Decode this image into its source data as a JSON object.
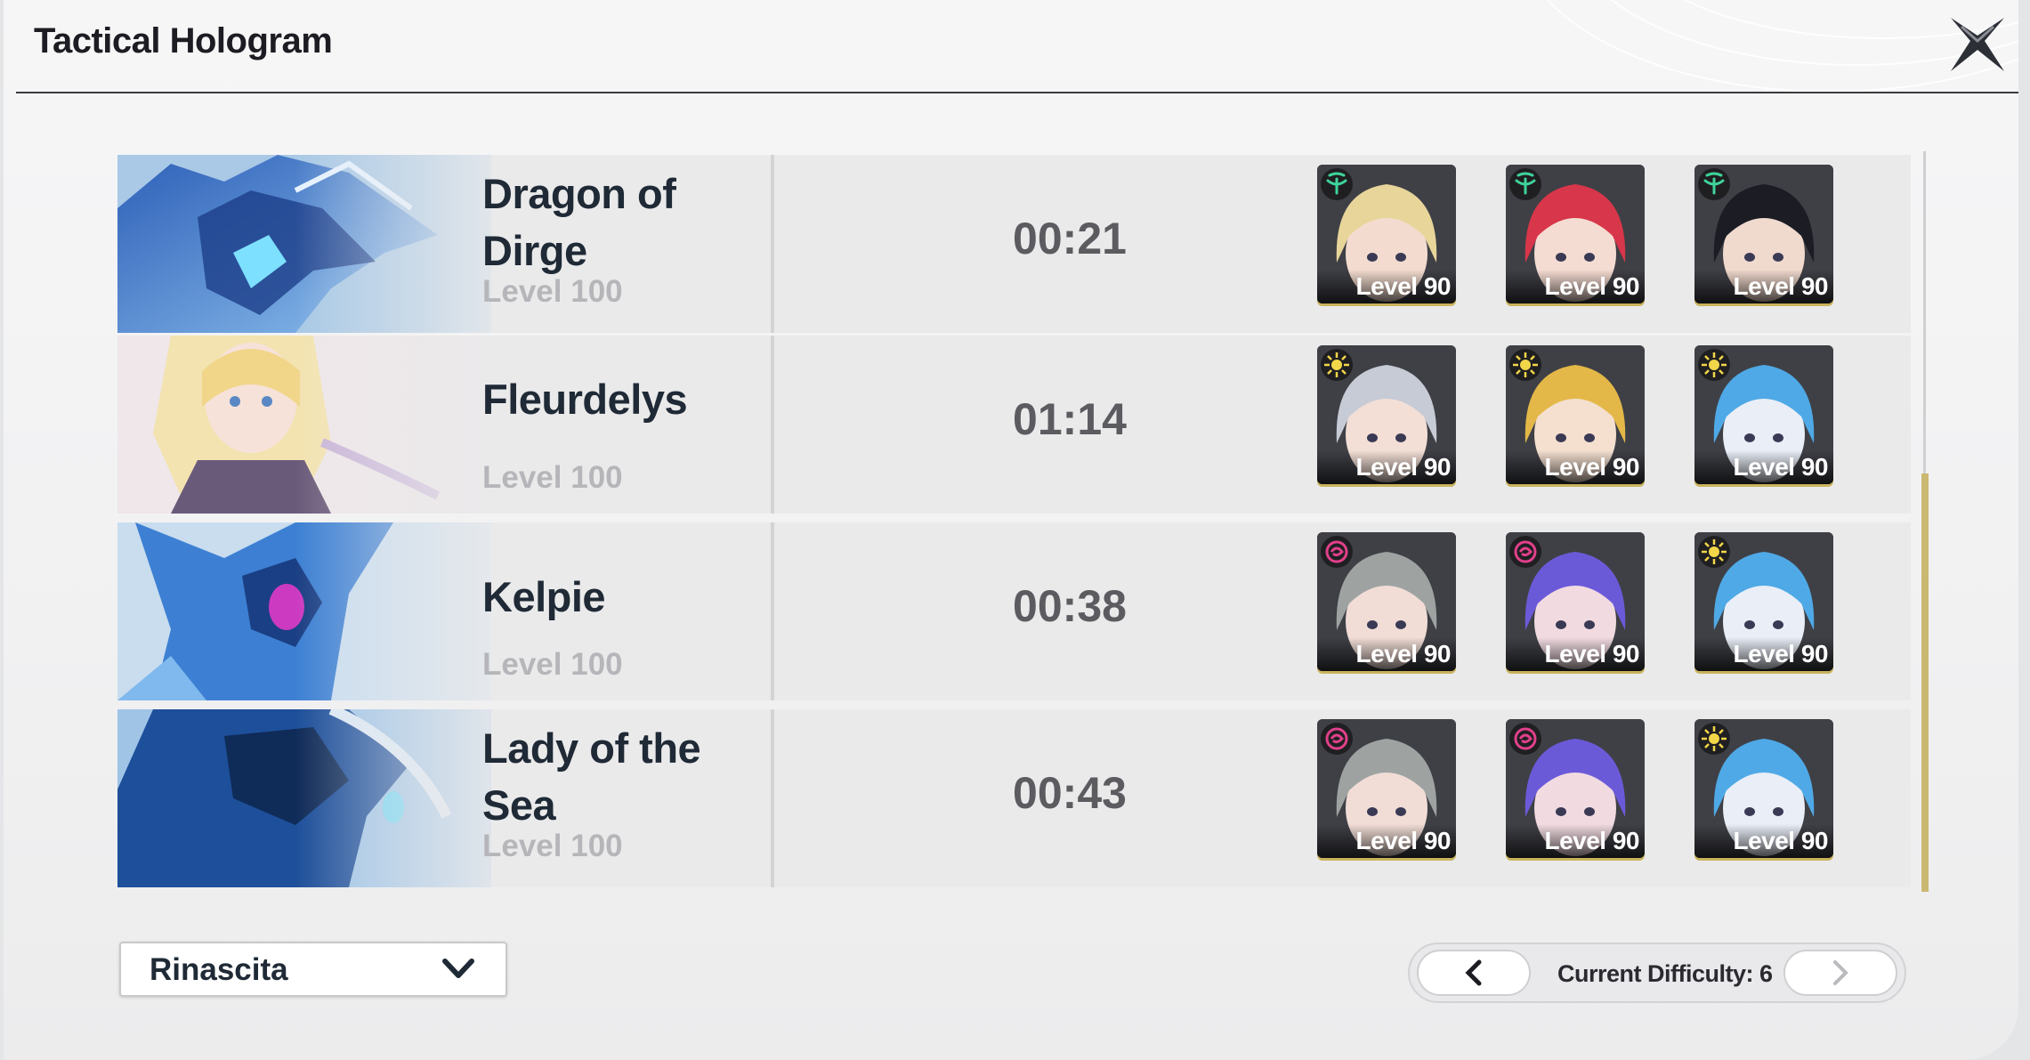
{
  "window": {
    "title": "Tactical Hologram",
    "close_icon": "close-x-icon"
  },
  "rows": [
    {
      "boss": "Dragon of Dirge",
      "level": "Level 100",
      "time": "00:21",
      "team": [
        {
          "level": "Level 90",
          "element": "aero-icon",
          "element_color": "#3fd39a",
          "hair": "#e8d59a",
          "skin": "#f3dccf"
        },
        {
          "level": "Level 90",
          "element": "aero-icon",
          "element_color": "#3fd39a",
          "hair": "#d8364a",
          "skin": "#f5dcd2"
        },
        {
          "level": "Level 90",
          "element": "aero-icon",
          "element_color": "#3fd39a",
          "hair": "#1b1c24",
          "skin": "#f0d9cd"
        }
      ]
    },
    {
      "boss": "Fleurdelys",
      "level": "Level 100",
      "time": "01:14",
      "team": [
        {
          "level": "Level 90",
          "element": "spectro-icon",
          "element_color": "#f2d649",
          "hair": "#c7cbd6",
          "skin": "#f3dfd6"
        },
        {
          "level": "Level 90",
          "element": "spectro-icon",
          "element_color": "#f2d649",
          "hair": "#e3b848",
          "skin": "#f5e0d0"
        },
        {
          "level": "Level 90",
          "element": "spectro-icon",
          "element_color": "#f2d649",
          "hair": "#4fa9e6",
          "skin": "#e9eef7"
        }
      ]
    },
    {
      "boss": "Kelpie",
      "level": "Level 100",
      "time": "00:38",
      "team": [
        {
          "level": "Level 90",
          "element": "havoc-icon",
          "element_color": "#e0408a",
          "hair": "#9ea3a2",
          "skin": "#f1ddd6"
        },
        {
          "level": "Level 90",
          "element": "havoc-icon",
          "element_color": "#e0408a",
          "hair": "#6b5ad8",
          "skin": "#f1dbe1"
        },
        {
          "level": "Level 90",
          "element": "spectro-icon",
          "element_color": "#f2d649",
          "hair": "#4fa9e6",
          "skin": "#e9eef7"
        }
      ]
    },
    {
      "boss": "Lady of the Sea",
      "level": "Level 100",
      "time": "00:43",
      "team": [
        {
          "level": "Level 90",
          "element": "havoc-icon",
          "element_color": "#e0408a",
          "hair": "#9ea3a2",
          "skin": "#f1ddd6"
        },
        {
          "level": "Level 90",
          "element": "havoc-icon",
          "element_color": "#e0408a",
          "hair": "#6b5ad8",
          "skin": "#f1dbe1"
        },
        {
          "level": "Level 90",
          "element": "spectro-icon",
          "element_color": "#f2d649",
          "hair": "#4fa9e6",
          "skin": "#e9eef7"
        }
      ]
    }
  ],
  "region_select": {
    "value": "Rinascita",
    "icon": "chevron-down-icon"
  },
  "difficulty": {
    "label": "Current Difficulty: 6",
    "prev_icon": "chevron-left-icon",
    "next_icon": "chevron-right-icon"
  },
  "scrollbar": {
    "position": 1.0
  },
  "colors": {
    "accent": "#c9b35c",
    "title": "#1f2a36"
  }
}
